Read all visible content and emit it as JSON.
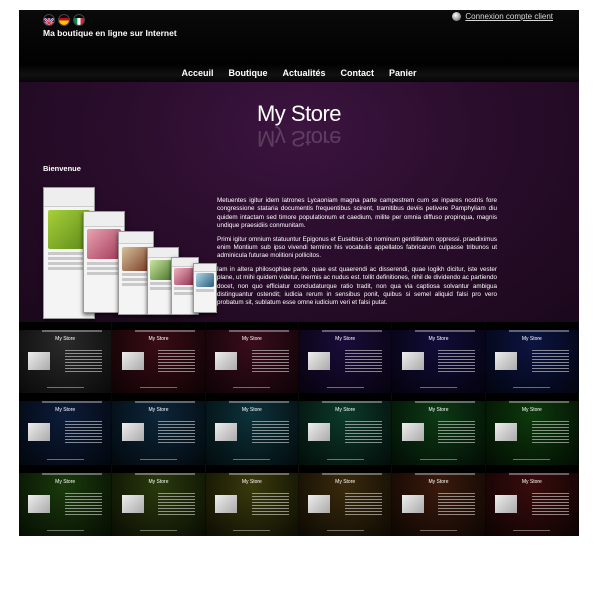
{
  "header": {
    "languages": [
      "english-flag-icon",
      "spanish-flag-icon",
      "italian-flag-icon"
    ],
    "shop_title": "Ma boutique en ligne sur Internet",
    "login_link": "Connexion compte client"
  },
  "nav": {
    "items": [
      "Acceuil",
      "Boutique",
      "Actualités",
      "Contact",
      "Panier"
    ]
  },
  "main": {
    "logo": "My Store",
    "welcome": "Bienvenue",
    "paragraphs": [
      "Metuentes igitur idem latrones Lycaoniam magna parte campestrem cum se inpares nostris fore congressione stataria documentis frequentibus scirent, tramitibus deviis petivere Pamphyliam diu quidem intactam sed timore populationum et caedium, milite per omnia diffuso propinqua, magnis undique praesidiis conmunitam.",
      "Primi igitur omnium statuuntur Epigonus et Eusebius ob nominum gentilitatem oppressi. praediximus enim Montium sub ipso vivendi termino his vocabulis appellatos fabricarum culpasse tribunos ut adminicula futurae molitioni pollicitos.",
      "Iam in altera philosophiae parte. quae est quaerendi ac disserendi, quae logikh dicitur, iste vester plane, ut mihi quidem videtur, inermis ac nudus est. tollit definitiones, nihil de dividendo ac partiendo docet, non quo efficiatur concludaturque ratio tradit, non qua via captiosa solvantur ambigua distinguantur ostendit; iudicia rerum in sensibus ponit, quibus si semel aliquid falsi pro vero probatum sit, sublatum esse omne iudicium veri et falsi putat."
    ]
  },
  "theme_variants": {
    "logo": "My Store",
    "colors": [
      "#2a2a2a",
      "#3a0c14",
      "#3a0c1c",
      "#1a0c3a",
      "#120c3a",
      "#0c1442",
      "#0c1c3a",
      "#0c263a",
      "#0c323a",
      "#0c3a2a",
      "#0c3a14",
      "#0c3a0c",
      "#1a3a0c",
      "#2a3a0c",
      "#3a3a0c",
      "#3a2a0c",
      "#3a1a0c",
      "#3a0c0c"
    ]
  }
}
